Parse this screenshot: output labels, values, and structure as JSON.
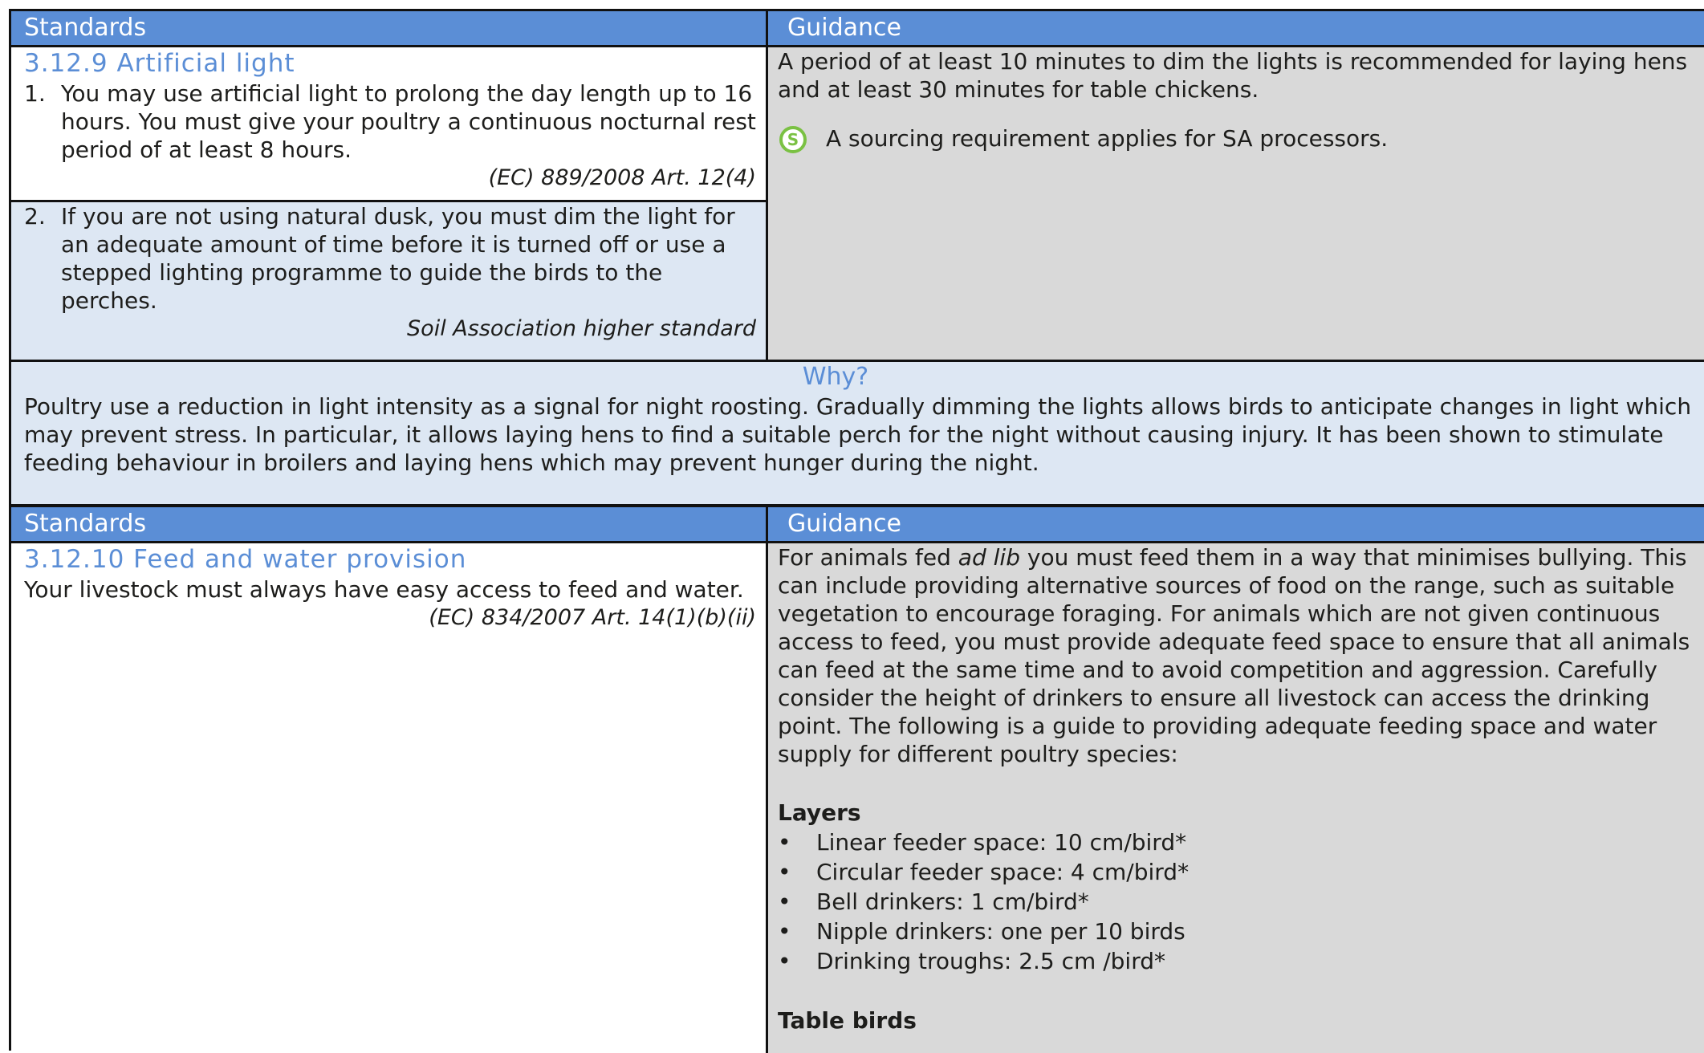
{
  "table1": {
    "header_standards": "Standards",
    "header_guidance": "Guidance",
    "section_title": "3.12.9 Artificial light",
    "item1": {
      "number": "1.",
      "text": "You may use artificial light to prolong the day length up to 16 hours. You must give your poultry a continuous nocturnal rest period of at least 8 hours.",
      "ref": "(EC) 889/2008 Art. 12(4)"
    },
    "item2": {
      "number": "2.",
      "text": "If you are not using natural dusk, you must dim the light for an adequate amount of time before it is turned off or use a stepped lighting programme to guide the birds to the perches.",
      "ref": "Soil Association higher standard"
    },
    "guidance_text": "A period of at least 10 minutes to dim the lights is recommended for laying hens and at least 30 minutes for table chickens.",
    "sourcing_icon": "sourcing-s-icon",
    "sourcing_icon_letter": "S",
    "sourcing_note": "A sourcing requirement applies for SA processors."
  },
  "why": {
    "title": "Why?",
    "text": "Poultry use a reduction in light intensity as a signal for night roosting. Gradually dimming the lights allows birds to anticipate changes in light which may prevent stress. In particular, it allows laying hens to find a suitable perch for the night without causing injury. It has been shown to stimulate feeding behaviour in broilers and laying hens which may prevent hunger during the night."
  },
  "table2": {
    "header_standards": "Standards",
    "header_guidance": "Guidance",
    "section_title": "3.12.10 Feed and water provision",
    "standard_text": "Your livestock must always have easy access to feed and water.",
    "ref": "(EC) 834/2007 Art. 14(1)(b)(ii)",
    "guidance_intro_before": "For animals fed ",
    "guidance_intro_italic": "ad lib",
    "guidance_intro_after": " you must feed them in a way that minimises bullying. This can include providing alternative sources of food on the range, such as suitable vegetation to encourage foraging. For animals which are not given continuous access to feed, you must provide adequate feed space to ensure that all animals can feed at the same time and to avoid competition and aggression. Carefully consider the height of drinkers to ensure all livestock can access the drinking point. The following is a guide to providing adequate feeding space and water supply for different poultry species:",
    "layers_heading": "Layers",
    "bullet_symbol": "•",
    "layers_items": [
      "Linear feeder space: 10 cm/bird*",
      "Circular feeder space: 4 cm/bird*",
      "Bell drinkers: 1 cm/bird*",
      "Nipple drinkers: one per 10 birds",
      "Drinking troughs: 2.5 cm /bird*"
    ],
    "table_birds_heading": "Table birds"
  },
  "colors": {
    "header_blue": "#5b8ed6",
    "title_blue": "#5b8ed6",
    "light_blue_bg": "#dde7f3",
    "gray_bg": "#d9d9d9",
    "icon_green": "#7ac143"
  }
}
